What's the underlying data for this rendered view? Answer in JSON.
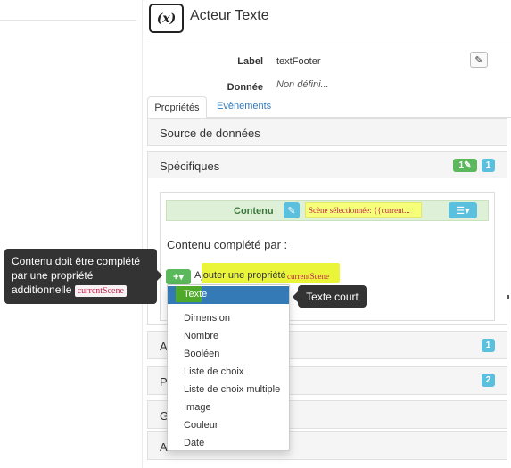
{
  "header": {
    "icon_text": "(x)",
    "title": "Acteur Texte"
  },
  "fields": {
    "label_key": "Label",
    "label_value": "textFooter",
    "data_key": "Donnée",
    "data_value": "Non défini..."
  },
  "tabs": [
    {
      "label": "Propriétés"
    },
    {
      "label": "Evènements"
    }
  ],
  "panels": {
    "source": "Source de données",
    "specifics": "Spécifiques",
    "specifics_badge_count": "1",
    "collapsed": [
      {
        "prefix": "As",
        "badge": "1"
      },
      {
        "prefix": "Po",
        "badge": "2"
      },
      {
        "prefix": "G"
      },
      {
        "prefix": "Ac"
      }
    ]
  },
  "contenu": {
    "label": "Contenu",
    "value": "Scène sélectionnée: {{current..."
  },
  "completed_by": "Contenu complété par :",
  "add_property": {
    "text": "Ajouter une propriété",
    "code": "currentScene"
  },
  "dropdown": {
    "items": [
      "Texte",
      "Dimension",
      "Nombre",
      "Booléen",
      "Liste de choix",
      "Liste de choix multiple",
      "Image",
      "Couleur",
      "Date"
    ],
    "selected_index": 0
  },
  "tooltips": {
    "left_text": "Contenu doit être complété par une propriété additionnelle",
    "left_code": "currentScene",
    "right_text": "Texte court"
  },
  "colors": {
    "success": "#5cb85c",
    "info": "#5bc0de",
    "primary": "#337ab7",
    "highlight": "#eaf53a",
    "tooltip": "#333333"
  }
}
